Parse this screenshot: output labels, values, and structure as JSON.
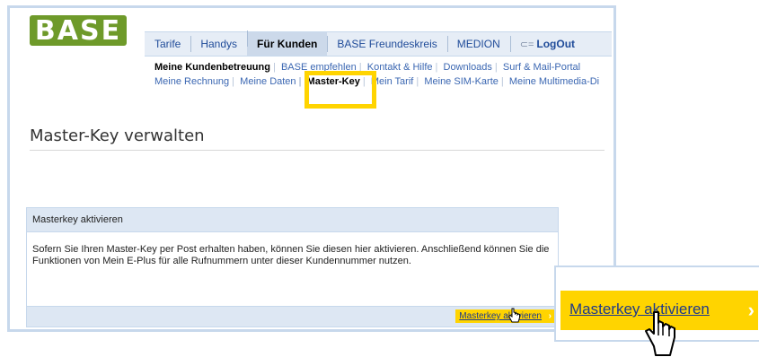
{
  "logo": {
    "text": "BASE"
  },
  "topnav": {
    "items": [
      {
        "label": "Tarife"
      },
      {
        "label": "Handys"
      },
      {
        "label": "Für Kunden"
      },
      {
        "label": "BASE Freundeskreis"
      },
      {
        "label": "MEDION"
      },
      {
        "label": "LogOut"
      }
    ],
    "active_index": 2
  },
  "subnav_row1": [
    {
      "label": "Meine Kundenbetreuung"
    },
    {
      "label": "BASE empfehlen"
    },
    {
      "label": "Kontakt & Hilfe"
    },
    {
      "label": "Downloads"
    },
    {
      "label": "Surf & Mail-Portal"
    }
  ],
  "subnav_row2": [
    {
      "label": "Meine Rechnung"
    },
    {
      "label": "Meine Daten"
    },
    {
      "label": "Master-Key"
    },
    {
      "label": "Mein Tarif"
    },
    {
      "label": "Meine SIM-Karte"
    },
    {
      "label": "Meine Multimedia-Di"
    }
  ],
  "page": {
    "title": "Master-Key verwalten"
  },
  "panel": {
    "heading": "Masterkey aktivieren",
    "body_line1": "Sofern Sie Ihren Master-Key per Post erhalten haben, können Sie diesen hier aktivieren. Anschließend können Sie die",
    "body_line2": "Funktionen von Mein E-Plus für alle Rufnummern unter dieser Kundennummer nutzen.",
    "button_label": "Masterkey aktivieren"
  },
  "zoom": {
    "button_label": "Masterkey aktivieren"
  },
  "colors": {
    "brand_green": "#6e9a2a",
    "highlight_yellow": "#ffd400",
    "nav_blue": "#1f4b99"
  }
}
